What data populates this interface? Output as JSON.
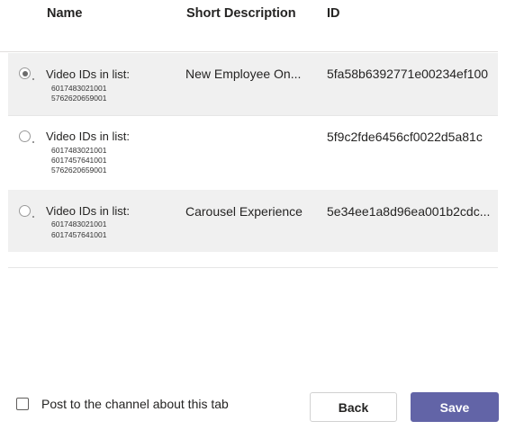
{
  "table": {
    "headers": {
      "name": "Name",
      "description": "Short Description",
      "id": "ID"
    },
    "rows": [
      {
        "selected": true,
        "name_label": "Video IDs in list:",
        "video_ids": [
          "6017483021001",
          "5762620659001"
        ],
        "description": "New Employee On...",
        "id": "5fa58b6392771e00234ef100"
      },
      {
        "selected": false,
        "name_label": "Video IDs in list:",
        "video_ids": [
          "6017483021001",
          "6017457641001",
          "5762620659001"
        ],
        "description": "",
        "id": "5f9c2fde6456cf0022d5a81c"
      },
      {
        "selected": false,
        "name_label": "Video IDs in list:",
        "video_ids": [
          "6017483021001",
          "6017457641001"
        ],
        "description": "Carousel Experience",
        "id": "5e34ee1a8d96ea001b2cdc..."
      }
    ]
  },
  "footer": {
    "post_to_channel_label": "Post to the channel about this tab",
    "post_to_channel_checked": false,
    "back_label": "Back",
    "save_label": "Save"
  },
  "colors": {
    "accent": "#6264a7",
    "row_shade": "#f0f0f0",
    "divider": "#e1dfdd"
  }
}
